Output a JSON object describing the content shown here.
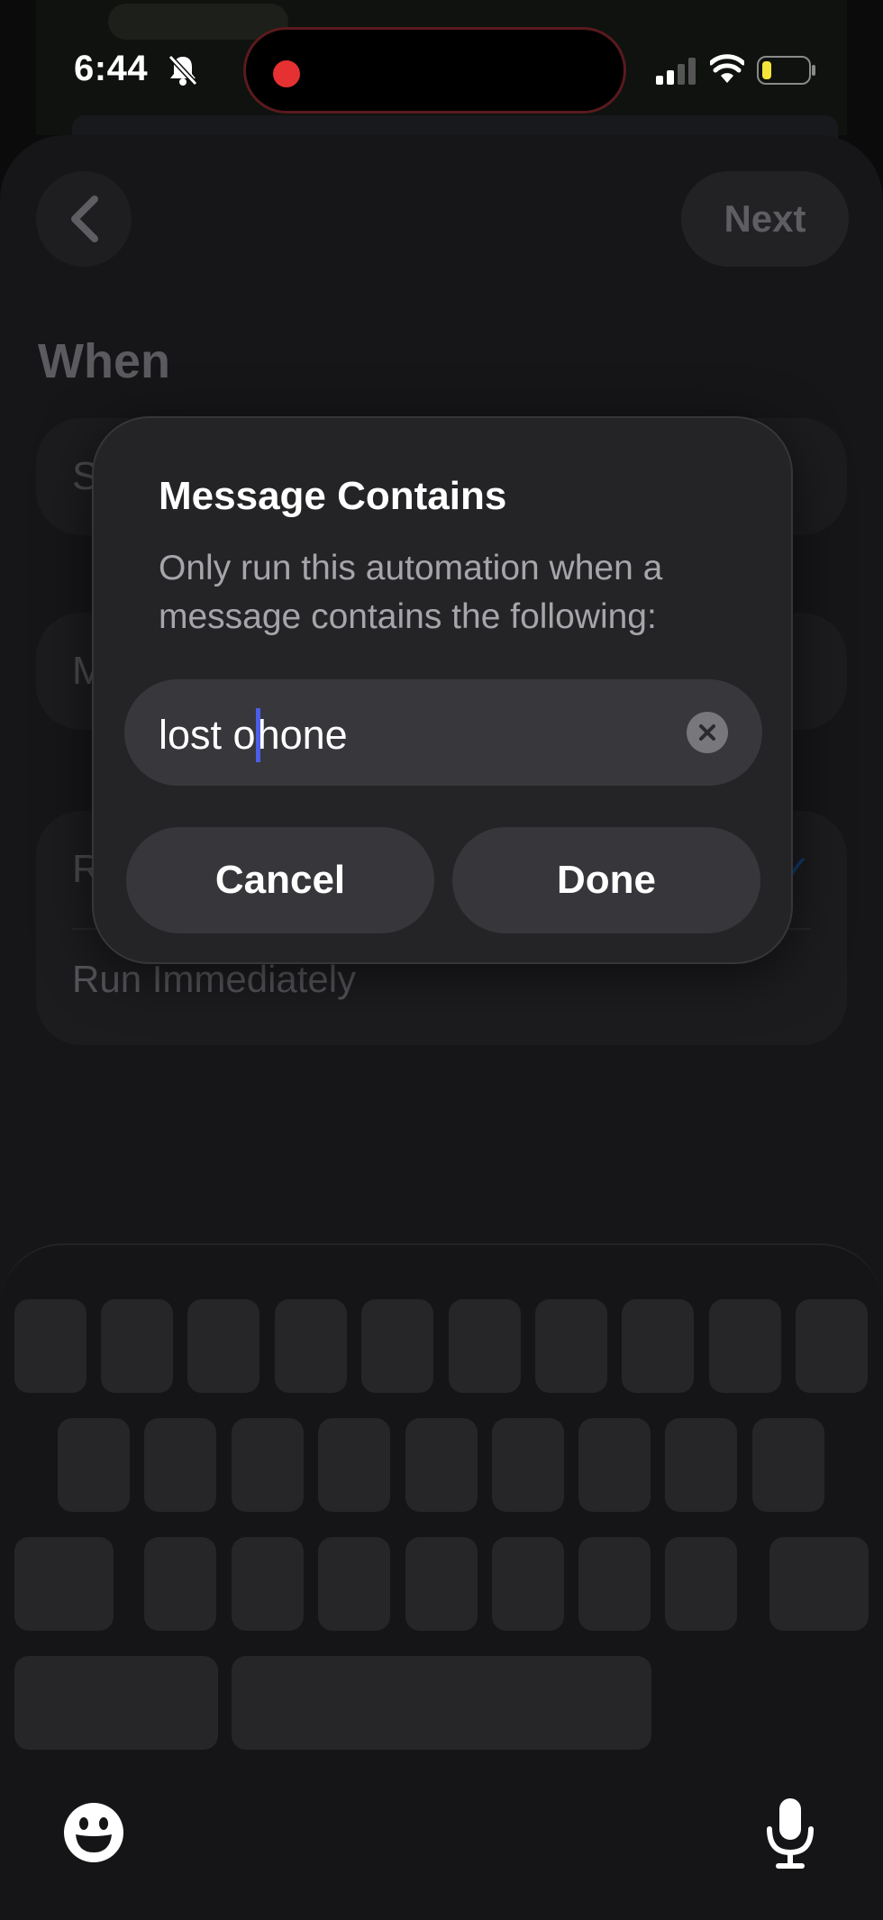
{
  "status_bar": {
    "time": "6:44",
    "icons": [
      "bell-slash-icon",
      "record-dot-icon",
      "signal-icon",
      "wifi-icon",
      "battery-icon"
    ],
    "colors": {
      "record": "#e53131",
      "battery_fill": "#f5e53a"
    }
  },
  "header": {
    "next_label": "Next",
    "back_icon": "chevron-left-icon"
  },
  "section": {
    "title": "When"
  },
  "rows": {
    "row1_letter": "S",
    "row2_letter": "M",
    "row3_letter": "R",
    "run_label": "Run Immediately"
  },
  "dialog": {
    "title": "Message Contains",
    "description": "Only run this automation when a message contains the following:",
    "input_before_caret": "lost o",
    "input_after_caret": "hone",
    "cancel_label": "Cancel",
    "done_label": "Done",
    "clear_icon": "clear-x-icon"
  },
  "keyboard": {
    "emoji_icon": "emoji-icon",
    "mic_icon": "microphone-icon"
  },
  "colors": {
    "sheet_bg": "#161618",
    "dialog_bg": "#242427",
    "caret": "#4b5ee8",
    "link": "#0d3c6c"
  }
}
